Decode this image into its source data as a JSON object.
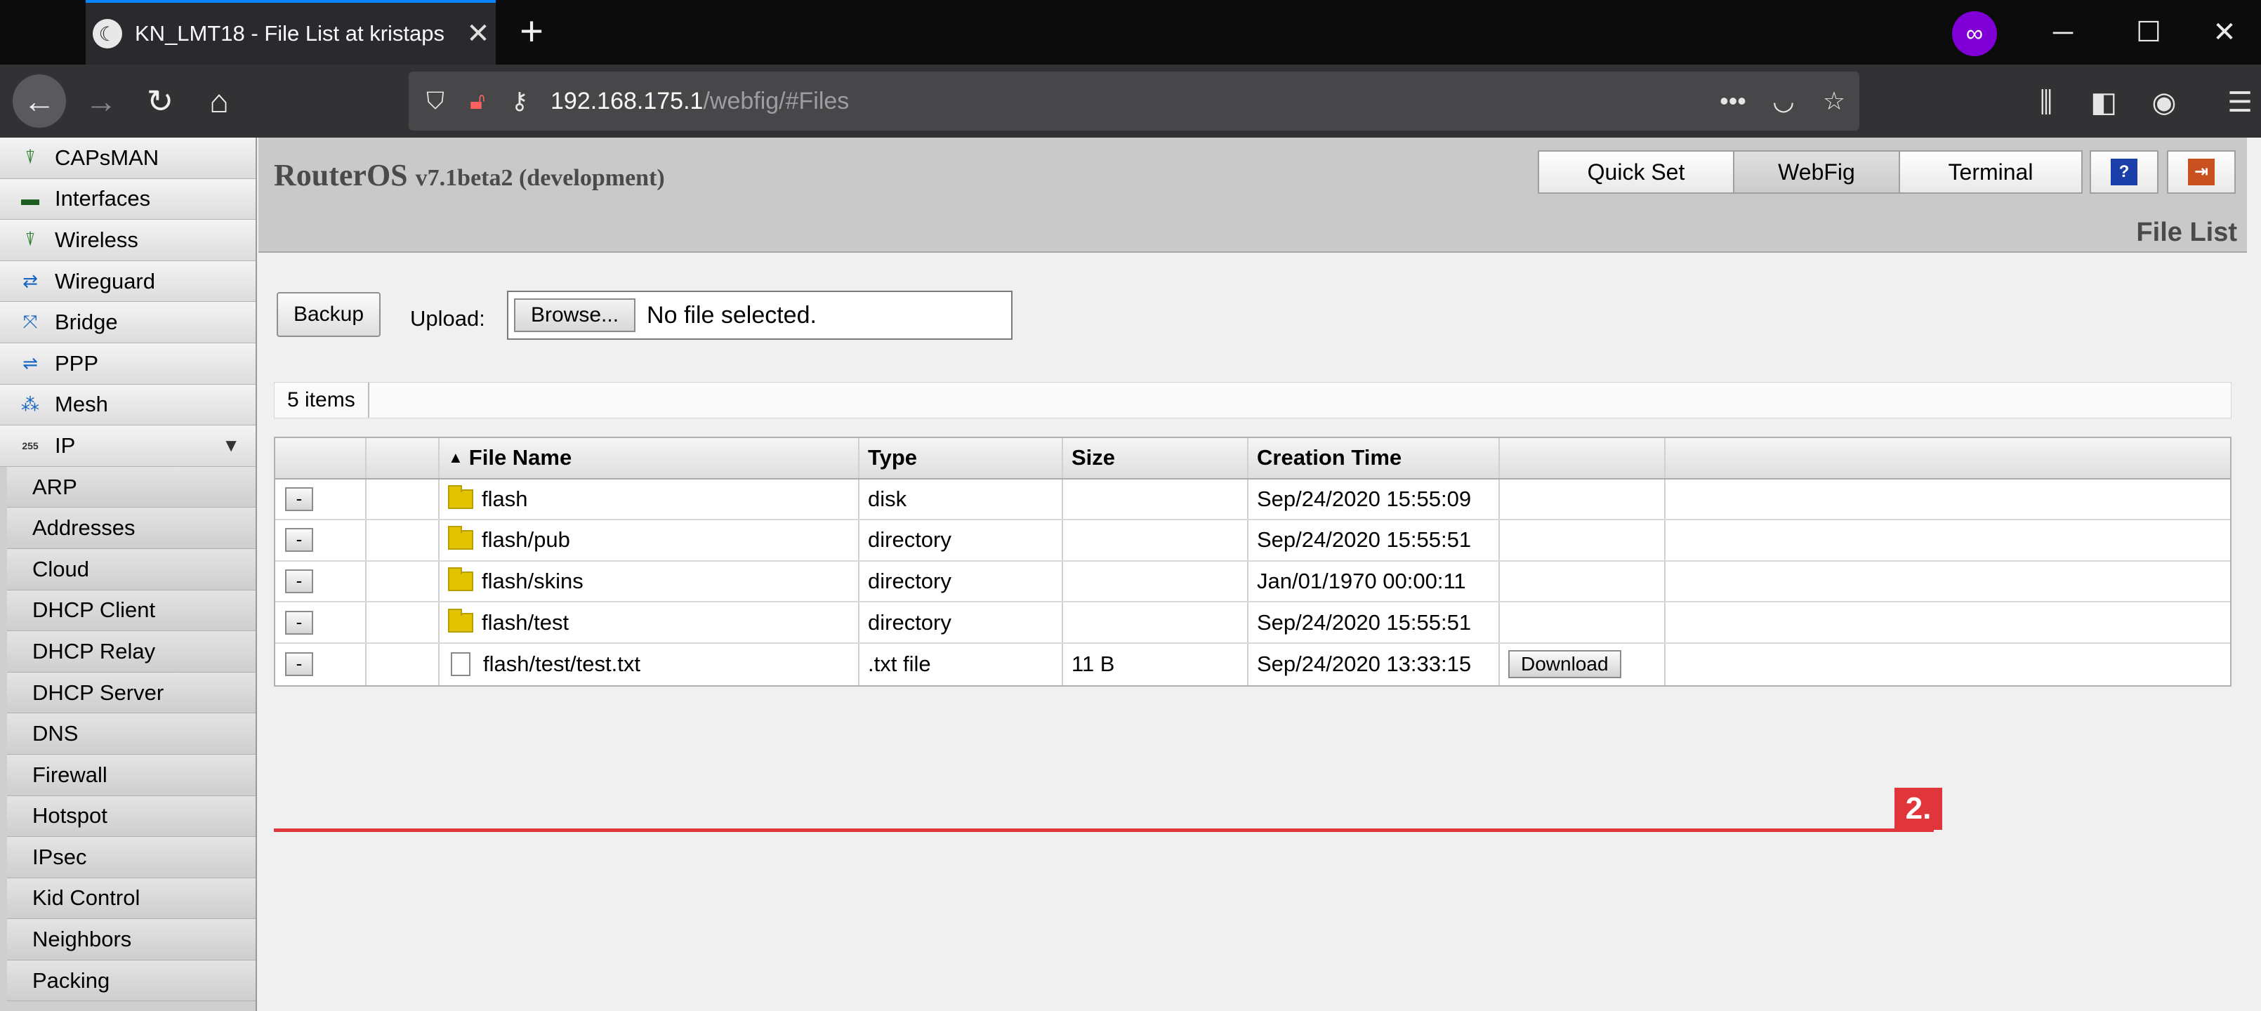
{
  "browser": {
    "tab_title": "KN_LMT18 - File List at kristaps",
    "tab_close": "✕",
    "new_tab": "+",
    "url_host": "192.168.175.1",
    "url_path": "/webfig/#Files",
    "menu_dots": "•••"
  },
  "sidebar": {
    "items": [
      {
        "label": "CAPsMAN",
        "icon": "antenna-icon"
      },
      {
        "label": "Interfaces",
        "icon": "interfaces-icon"
      },
      {
        "label": "Wireless",
        "icon": "antenna-icon"
      },
      {
        "label": "Wireguard",
        "icon": "wireguard-icon"
      },
      {
        "label": "Bridge",
        "icon": "bridge-icon"
      },
      {
        "label": "PPP",
        "icon": "ppp-icon"
      },
      {
        "label": "Mesh",
        "icon": "mesh-icon"
      },
      {
        "label": "IP",
        "icon": "ip-icon",
        "expanded": true
      }
    ],
    "sub_items": [
      "ARP",
      "Addresses",
      "Cloud",
      "DHCP Client",
      "DHCP Relay",
      "DHCP Server",
      "DNS",
      "Firewall",
      "Hotspot",
      "IPsec",
      "Kid Control",
      "Neighbors",
      "Packing"
    ],
    "ip_icon_text": "255",
    "expand_arrow": "▼"
  },
  "header": {
    "title": "RouterOS",
    "version": "v7.1beta2 (development)",
    "modes": [
      "Quick Set",
      "WebFig",
      "Terminal"
    ],
    "active_mode": "WebFig",
    "page_title": "File List"
  },
  "toolbar": {
    "backup_label": "Backup",
    "upload_label": "Upload:",
    "browse_label": "Browse...",
    "file_status": "No file selected.",
    "items_count": "5 items"
  },
  "table": {
    "columns": [
      "File Name",
      "Type",
      "Size",
      "Creation Time"
    ],
    "sort_indicator": "▲",
    "rows": [
      {
        "name": "flash",
        "type": "disk",
        "size": "",
        "created": "Sep/24/2020 15:55:09",
        "kind": "folder"
      },
      {
        "name": "flash/pub",
        "type": "directory",
        "size": "",
        "created": "Sep/24/2020 15:55:51",
        "kind": "folder"
      },
      {
        "name": "flash/skins",
        "type": "directory",
        "size": "",
        "created": "Jan/01/1970 00:00:11",
        "kind": "folder"
      },
      {
        "name": "flash/test",
        "type": "directory",
        "size": "",
        "created": "Sep/24/2020 15:55:51",
        "kind": "folder"
      },
      {
        "name": "flash/test/test.txt",
        "type": ".txt file",
        "size": "11 B",
        "created": "Sep/24/2020 13:33:15",
        "kind": "file"
      }
    ],
    "remove_label": "-",
    "download_label": "Download"
  },
  "annotation": {
    "step_label": "2.",
    "color": "#e0353b"
  }
}
